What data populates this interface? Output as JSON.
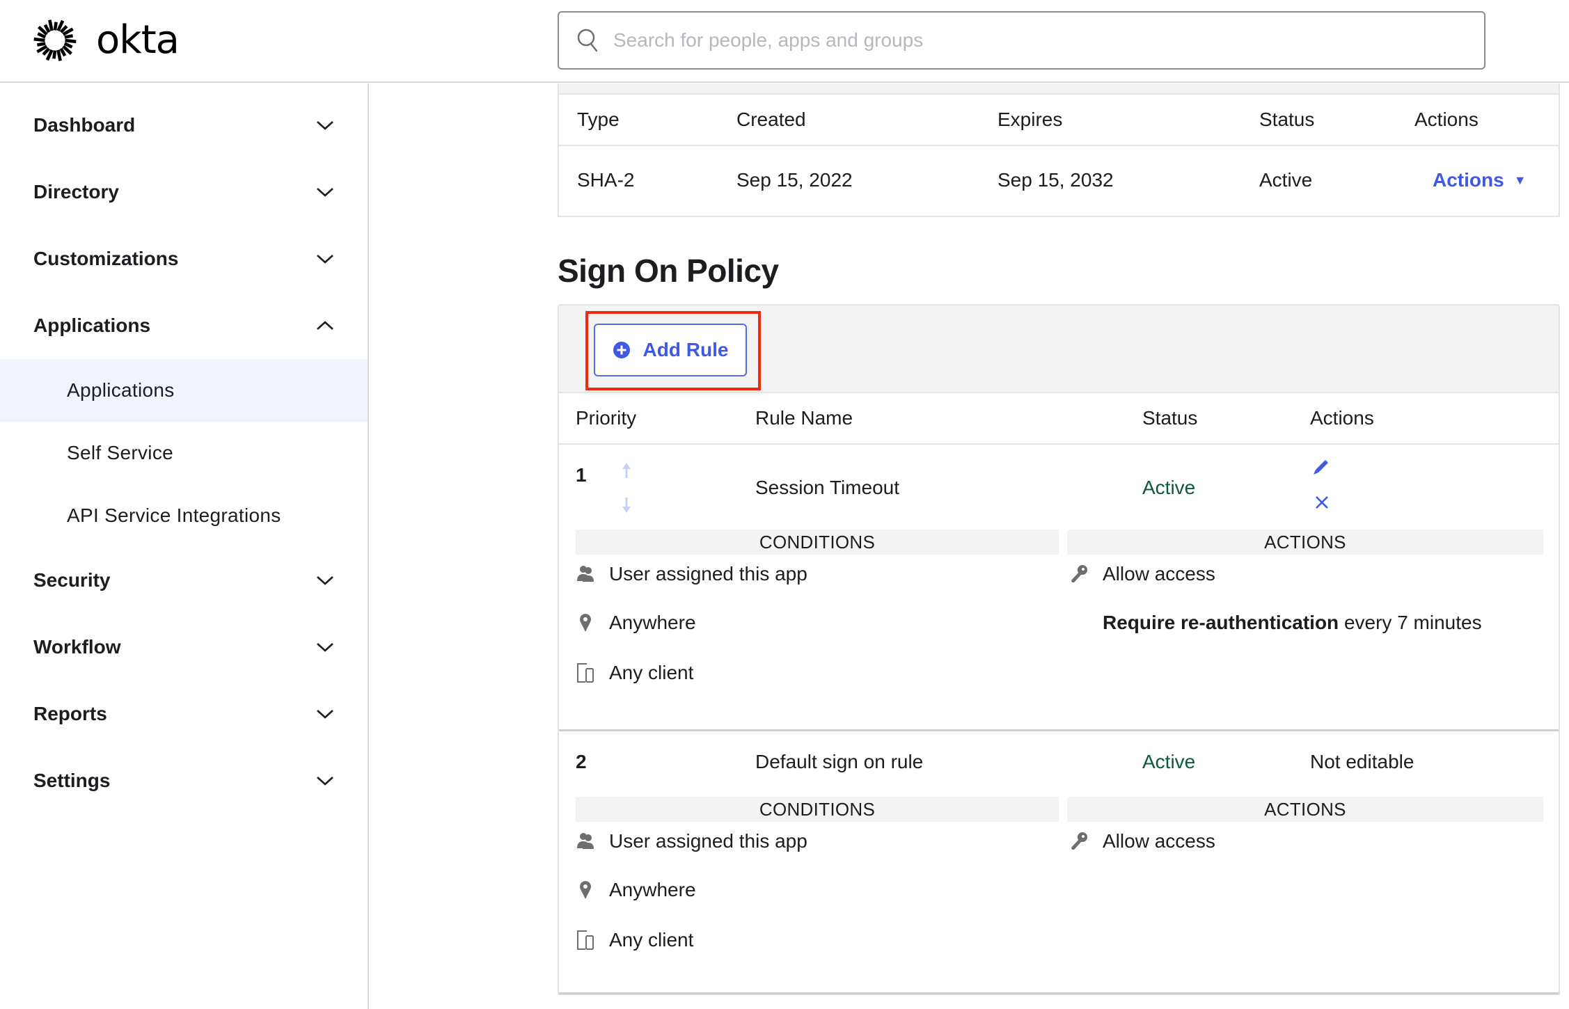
{
  "header": {
    "logo_text": "okta",
    "search_placeholder": "Search for people, apps and groups",
    "search_value": ""
  },
  "sidebar": {
    "items": [
      {
        "label": "Dashboard",
        "expanded": false
      },
      {
        "label": "Directory",
        "expanded": false
      },
      {
        "label": "Customizations",
        "expanded": false
      },
      {
        "label": "Applications",
        "expanded": true,
        "children": [
          {
            "label": "Applications",
            "active": true
          },
          {
            "label": "Self Service",
            "active": false
          },
          {
            "label": "API Service Integrations",
            "active": false
          }
        ]
      },
      {
        "label": "Security",
        "expanded": false
      },
      {
        "label": "Workflow",
        "expanded": false
      },
      {
        "label": "Reports",
        "expanded": false
      },
      {
        "label": "Settings",
        "expanded": false
      }
    ]
  },
  "certificates": {
    "columns": [
      "Type",
      "Created",
      "Expires",
      "Status",
      "Actions"
    ],
    "rows": [
      {
        "type": "SHA-2",
        "created": "Sep 15, 2022",
        "expires": "Sep 15, 2032",
        "status": "Active",
        "actions_label": "Actions",
        "actions_caret": "▼"
      }
    ]
  },
  "sign_on_policy": {
    "title": "Sign On Policy",
    "add_rule_label": "Add Rule",
    "columns": [
      "Priority",
      "Rule Name",
      "Status",
      "Actions"
    ],
    "conditions_label": "CONDITIONS",
    "actions_label": "ACTIONS",
    "rules": [
      {
        "priority": "1",
        "name": "Session Timeout",
        "status": "Active",
        "actions": [
          "edit-icon",
          "delete-icon"
        ],
        "conditions": [
          "User assigned this app",
          "Anywhere",
          "Any client"
        ],
        "rule_actions": [
          "Allow access"
        ],
        "reauth": {
          "bold": "Require re-authentication",
          "rest": " every 7 minutes"
        }
      },
      {
        "priority": "2",
        "name": "Default sign on rule",
        "status": "Active",
        "actions_text": "Not editable",
        "conditions": [
          "User assigned this app",
          "Anywhere",
          "Any client"
        ],
        "rule_actions": [
          "Allow access"
        ]
      }
    ]
  },
  "colors": {
    "accent": "#3f59e4",
    "status_active": "#0b5a3a",
    "highlight": "#ee2a12",
    "active_nav_bg": "#f1f4fd"
  }
}
